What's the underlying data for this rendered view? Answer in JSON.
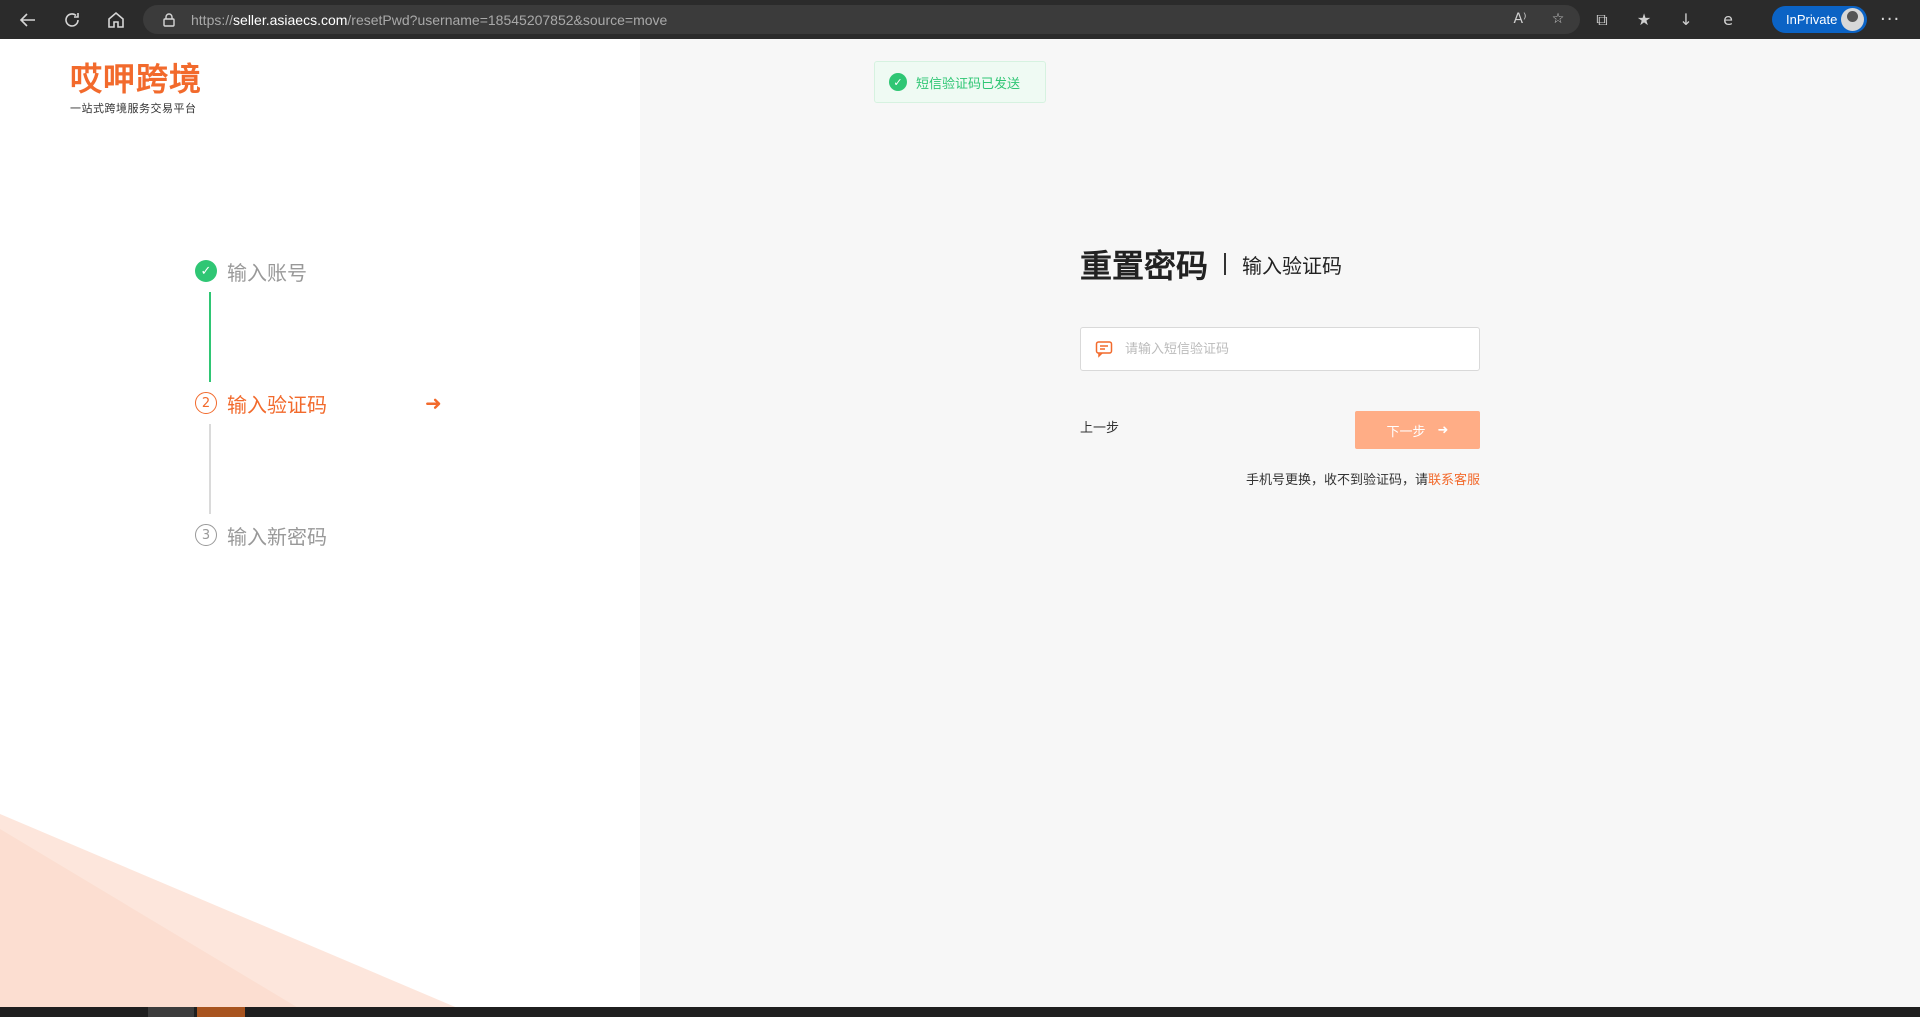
{
  "browser": {
    "url_scheme": "https://",
    "url_host": "seller.asiaecs.com",
    "url_path": "/resetPwd?username=18545207852&source=move",
    "inprivate_label": "InPrivate"
  },
  "brand": {
    "name": "哎呷跨境",
    "tagline": "一站式跨境服务交易平台",
    "accent_color": "#f26a2c",
    "success_color": "#2fc674"
  },
  "steps": [
    {
      "number": "1",
      "label": "输入账号",
      "status": "done"
    },
    {
      "number": "2",
      "label": "输入验证码",
      "status": "active"
    },
    {
      "number": "3",
      "label": "输入新密码",
      "status": "todo"
    }
  ],
  "toast": {
    "message": "短信验证码已发送",
    "icon": "check-circle-icon"
  },
  "form": {
    "title": "重置密码",
    "subtitle": "输入验证码",
    "code_placeholder": "请输入短信验证码",
    "code_value": "",
    "prev_label": "上一步",
    "next_label": "下一步",
    "hint_text": "手机号更换，收不到验证码，请",
    "hint_link": "联系客服"
  }
}
